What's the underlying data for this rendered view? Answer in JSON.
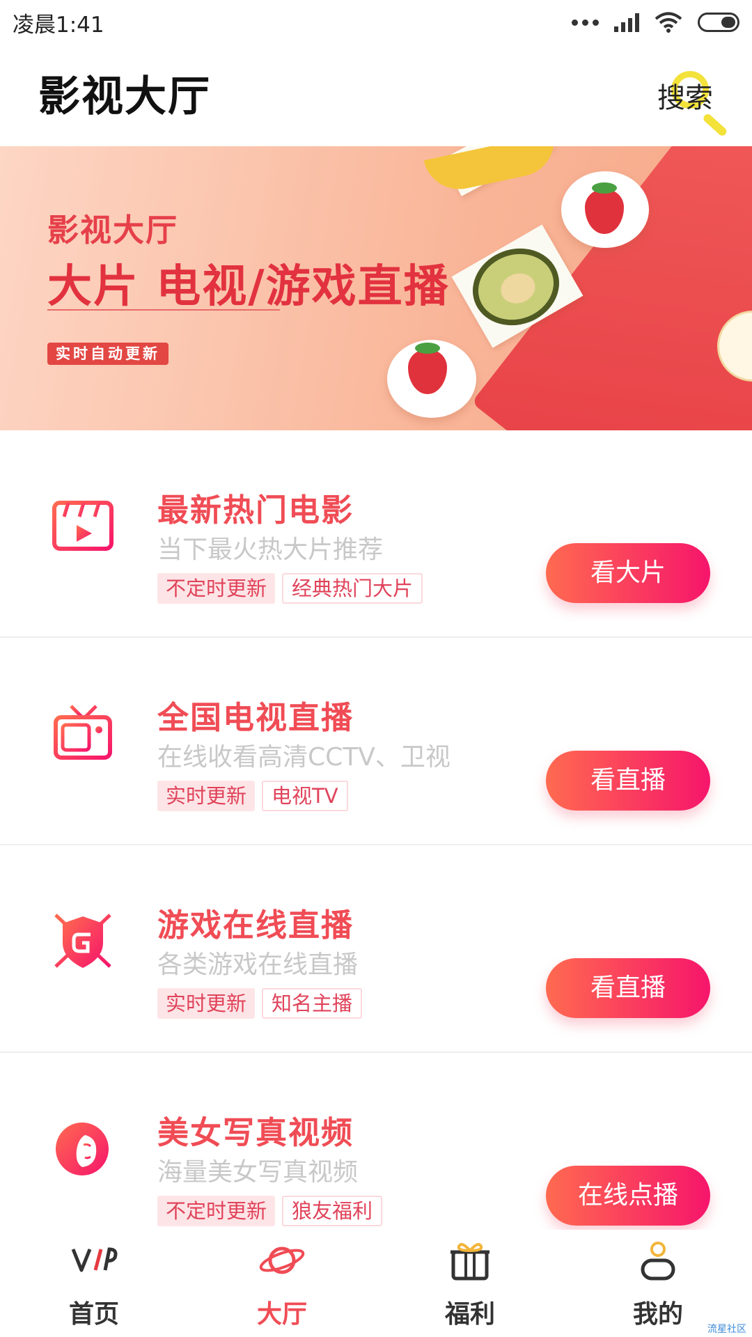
{
  "status_bar": {
    "time": "凌晨1:41"
  },
  "header": {
    "title": "影视大厅",
    "search_label": "搜索"
  },
  "banner": {
    "subtitle": "影视大厅",
    "title": "大片 电视/游戏直播",
    "tag": "实时自动更新"
  },
  "items": [
    {
      "title": "最新热门电影",
      "desc": "当下最火热大片推荐",
      "tags": [
        "不定时更新",
        "经典热门大片"
      ],
      "button": "看大片",
      "icon": "film-clapper-icon"
    },
    {
      "title": "全国电视直播",
      "desc": "在线收看高清CCTV、卫视",
      "tags": [
        "实时更新",
        "电视TV"
      ],
      "button": "看直播",
      "icon": "tv-icon"
    },
    {
      "title": "游戏在线直播",
      "desc": "各类游戏在线直播",
      "tags": [
        "实时更新",
        "知名主播"
      ],
      "button": "看直播",
      "icon": "game-shield-icon"
    },
    {
      "title": "美女写真视频",
      "desc": "海量美女写真视频",
      "tags": [
        "不定时更新",
        "狼友福利"
      ],
      "button": "在线点播",
      "icon": "woman-portrait-icon"
    }
  ],
  "bottom_nav": [
    {
      "label": "首页",
      "icon": "vip-icon",
      "active": false
    },
    {
      "label": "大厅",
      "icon": "planet-icon",
      "active": true
    },
    {
      "label": "福利",
      "icon": "gift-icon",
      "active": false
    },
    {
      "label": "我的",
      "icon": "user-icon",
      "active": false
    }
  ],
  "watermark": "流星社区",
  "colors": {
    "accent": "#f04c55",
    "button_start": "#ff6a50",
    "button_end": "#f6156b",
    "tag_bg": "#fde5e7"
  }
}
